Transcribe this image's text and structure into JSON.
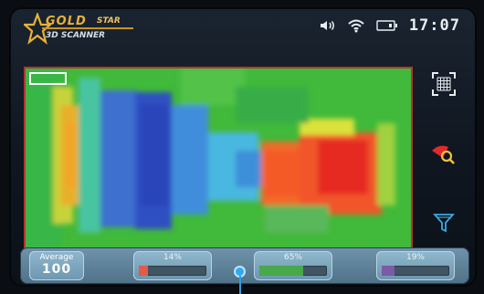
{
  "header": {
    "logo_line1": "GOLD",
    "logo_line1_suffix": "STAR",
    "logo_line2": "3D SCANNER",
    "time": "17:07"
  },
  "icons": {
    "volume": "volume-icon",
    "wifi": "wifi-icon",
    "battery": "battery-icon",
    "grid": "grid-view-icon",
    "scan_search": "scan-search-icon",
    "filter": "filter-icon"
  },
  "bottom_bar": {
    "average_label": "Average",
    "average_value": "100",
    "meters": [
      {
        "label": "14%",
        "value": 0.14,
        "color": "#e35a4a"
      },
      {
        "label": "65%",
        "value": 0.65,
        "color": "#47a94a"
      },
      {
        "label": "19%",
        "value": 0.19,
        "color": "#7b5aa6"
      }
    ]
  },
  "colors": {
    "frame": "#b7332f",
    "accent": "#e9b13a"
  }
}
